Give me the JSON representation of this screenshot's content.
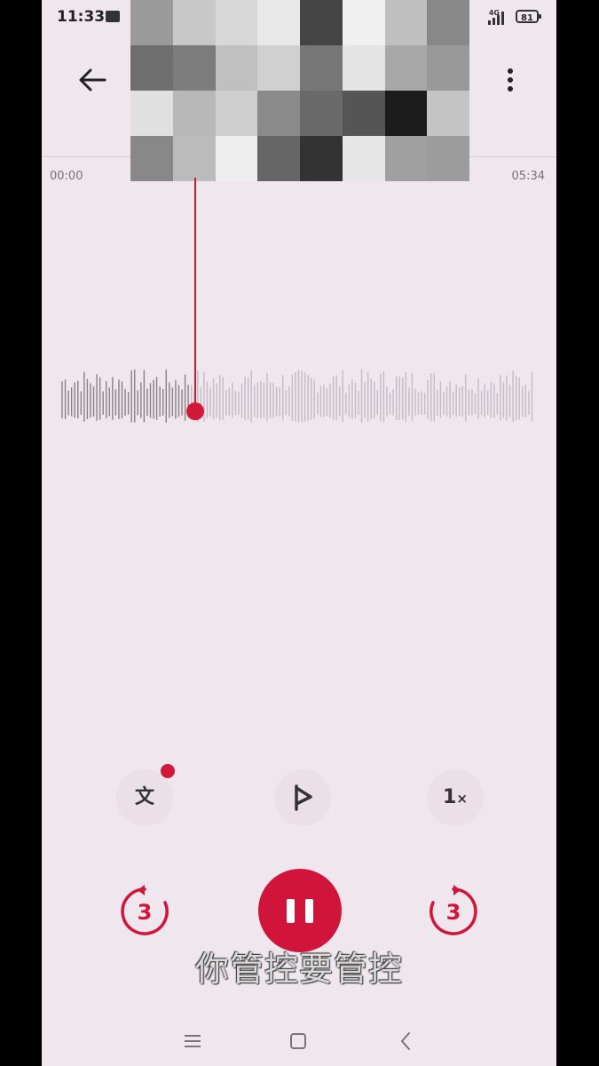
{
  "status_bar": {
    "time": "11:33",
    "network": "4G",
    "battery": "81"
  },
  "timeline": {
    "start": "00:00",
    "end": "05:34"
  },
  "controls": {
    "transcript_label": "文",
    "speed_label": "1",
    "speed_suffix": "×",
    "skip_back_seconds": "3",
    "skip_forward_seconds": "3"
  },
  "subtitle": "你管控要管控",
  "playback": {
    "progress_fraction": 0.27
  },
  "colors": {
    "accent": "#d0143a",
    "background": "#f0e6ee"
  },
  "icons": {
    "back": "arrow-left-icon",
    "more": "more-vertical-icon",
    "flag": "flag-icon",
    "pause": "pause-icon",
    "replay": "replay-icon",
    "forward": "forward-icon"
  }
}
